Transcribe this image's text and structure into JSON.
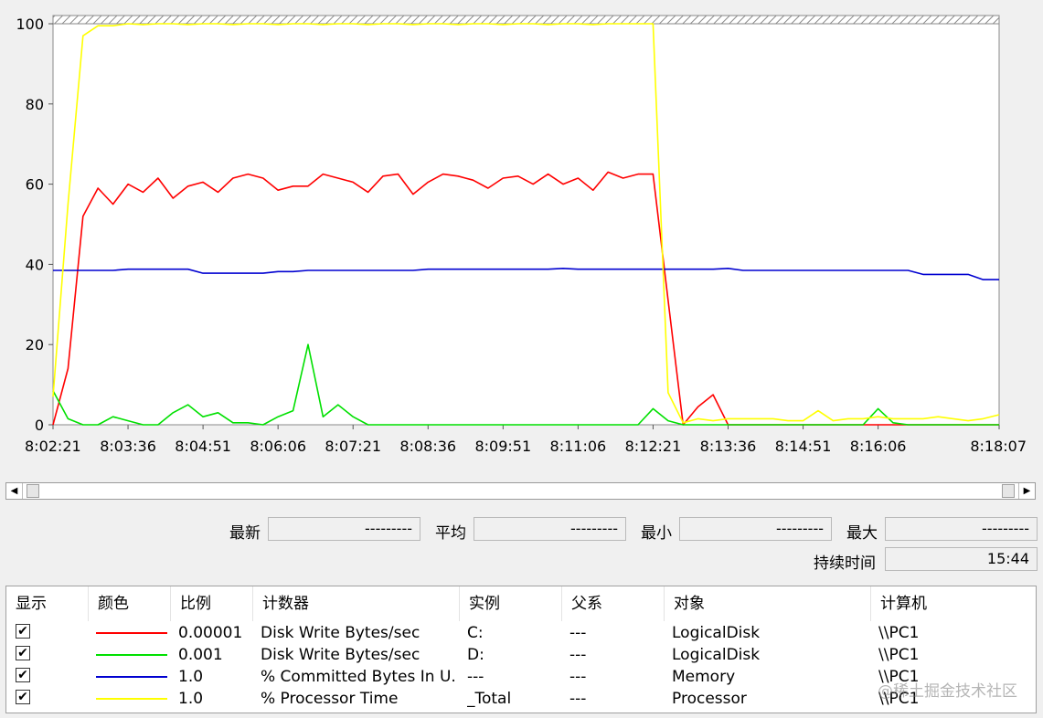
{
  "chart_data": {
    "type": "line",
    "ylim": [
      0,
      100
    ],
    "yticks": [
      "0",
      "20",
      "40",
      "60",
      "80",
      "100"
    ],
    "x_start": "8:02:21",
    "x_end": "8:18:07",
    "xticks": [
      "8:02:21",
      "8:03:36",
      "8:04:51",
      "8:06:06",
      "8:07:21",
      "8:08:36",
      "8:09:51",
      "8:11:06",
      "8:12:21",
      "8:13:36",
      "8:14:51",
      "8:16:06",
      "8:18:07"
    ],
    "grid": false,
    "x": [
      "8:02:21",
      "8:02:36",
      "8:02:51",
      "8:03:06",
      "8:03:21",
      "8:03:36",
      "8:03:51",
      "8:04:06",
      "8:04:21",
      "8:04:36",
      "8:04:51",
      "8:05:06",
      "8:05:21",
      "8:05:36",
      "8:05:51",
      "8:06:06",
      "8:06:21",
      "8:06:36",
      "8:06:51",
      "8:07:06",
      "8:07:21",
      "8:07:36",
      "8:07:51",
      "8:08:06",
      "8:08:21",
      "8:08:36",
      "8:08:51",
      "8:09:06",
      "8:09:21",
      "8:09:36",
      "8:09:51",
      "8:10:06",
      "8:10:21",
      "8:10:36",
      "8:10:51",
      "8:11:06",
      "8:11:21",
      "8:11:36",
      "8:11:51",
      "8:12:06",
      "8:12:21",
      "8:12:36",
      "8:12:51",
      "8:13:06",
      "8:13:21",
      "8:13:36",
      "8:13:51",
      "8:14:06",
      "8:14:21",
      "8:14:36",
      "8:14:51",
      "8:15:06",
      "8:15:21",
      "8:15:36",
      "8:15:51",
      "8:16:06",
      "8:16:21",
      "8:16:36",
      "8:16:51",
      "8:17:06",
      "8:17:21",
      "8:17:36",
      "8:17:51",
      "8:18:07"
    ],
    "series": [
      {
        "name": "Disk Write Bytes/sec C:",
        "color": "#ff0000",
        "values": [
          0,
          14,
          52,
          59,
          55,
          60,
          58,
          61.5,
          56.5,
          59.5,
          60.5,
          58,
          61.5,
          62.5,
          61.5,
          58.5,
          59.5,
          59.5,
          62.5,
          61.5,
          60.5,
          58,
          62,
          62.5,
          57.5,
          60.5,
          62.5,
          62,
          61,
          59,
          61.5,
          62,
          60,
          62.5,
          60,
          61.5,
          58.5,
          63,
          61.5,
          62.5,
          62.5,
          31,
          0,
          4.5,
          7.5,
          0,
          0,
          0,
          0,
          0,
          0,
          0,
          0,
          0,
          0,
          0,
          0,
          0,
          0,
          0,
          0,
          0,
          0,
          0
        ]
      },
      {
        "name": "Disk Write Bytes/sec D:",
        "color": "#00e000",
        "values": [
          8.5,
          1.5,
          0,
          0,
          2,
          1,
          0,
          0,
          3,
          5,
          2,
          3,
          0.5,
          0.5,
          0,
          2,
          3.5,
          20,
          2,
          5,
          2,
          0,
          0,
          0,
          0,
          0,
          0,
          0,
          0,
          0,
          0,
          0,
          0,
          0,
          0,
          0,
          0,
          0,
          0,
          0,
          4,
          1,
          0,
          0,
          0,
          0,
          0,
          0,
          0,
          0,
          0,
          0,
          0,
          0,
          0,
          4,
          0.5,
          0,
          0,
          0,
          0,
          0,
          0,
          0
        ]
      },
      {
        "name": "% Committed Bytes In Use",
        "color": "#0000d0",
        "values": [
          38.5,
          38.5,
          38.5,
          38.5,
          38.5,
          38.8,
          38.8,
          38.8,
          38.8,
          38.8,
          37.8,
          37.8,
          37.8,
          37.8,
          37.8,
          38.2,
          38.2,
          38.5,
          38.5,
          38.5,
          38.5,
          38.5,
          38.5,
          38.5,
          38.5,
          38.8,
          38.8,
          38.8,
          38.8,
          38.8,
          38.8,
          38.8,
          38.8,
          38.8,
          39,
          38.8,
          38.8,
          38.8,
          38.8,
          38.8,
          38.8,
          38.8,
          38.8,
          38.8,
          38.8,
          39,
          38.5,
          38.5,
          38.5,
          38.5,
          38.5,
          38.5,
          38.5,
          38.5,
          38.5,
          38.5,
          38.5,
          38.5,
          37.5,
          37.5,
          37.5,
          37.5,
          36.2,
          36.2
        ]
      },
      {
        "name": "% Processor Time",
        "color": "#ffff00",
        "values": [
          7,
          55,
          97,
          99.5,
          99.5,
          100,
          99.8,
          100,
          100,
          99.8,
          100,
          100,
          99.8,
          100,
          100,
          99.8,
          100,
          100,
          99.8,
          100,
          100,
          99.8,
          100,
          100,
          99.8,
          100,
          100,
          99.8,
          100,
          100,
          99.8,
          100,
          100,
          99.8,
          100,
          100,
          99.8,
          100,
          100,
          100,
          100,
          8,
          0.5,
          1.5,
          1,
          1.5,
          1.5,
          1.5,
          1.5,
          1,
          1,
          3.5,
          1,
          1.5,
          1.5,
          2,
          1.5,
          1.5,
          1.5,
          2,
          1.5,
          1,
          1.5,
          2.5
        ]
      }
    ]
  },
  "scrollbar": {
    "left_arrow": "◀",
    "right_arrow": "▶"
  },
  "stats": {
    "latest_label": "最新",
    "latest_value": "---------",
    "average_label": "平均",
    "average_value": "---------",
    "min_label": "最小",
    "min_value": "---------",
    "max_label": "最大",
    "max_value": "---------",
    "duration_label": "持续时间",
    "duration_value": "15:44"
  },
  "table": {
    "headers": {
      "show": "显示",
      "color": "颜色",
      "scale": "比例",
      "counter": "计数器",
      "instance": "实例",
      "parent": "父系",
      "object": "对象",
      "computer": "计算机"
    },
    "rows": [
      {
        "checked": "✔",
        "color": "#ff0000",
        "scale": "0.00001",
        "counter": "Disk Write Bytes/sec",
        "instance": "C:",
        "parent": "---",
        "object": "LogicalDisk",
        "computer": "\\\\PC1"
      },
      {
        "checked": "✔",
        "color": "#00e000",
        "scale": "0.001",
        "counter": "Disk Write Bytes/sec",
        "instance": "D:",
        "parent": "---",
        "object": "LogicalDisk",
        "computer": "\\\\PC1"
      },
      {
        "checked": "✔",
        "color": "#0000d0",
        "scale": "1.0",
        "counter": "% Committed Bytes In U...",
        "instance": "---",
        "parent": "---",
        "object": "Memory",
        "computer": "\\\\PC1"
      },
      {
        "checked": "✔",
        "color": "#ffff00",
        "scale": "1.0",
        "counter": "% Processor Time",
        "instance": "_Total",
        "parent": "---",
        "object": "Processor",
        "computer": "\\\\PC1"
      }
    ]
  },
  "watermark": "@稀土掘金技术社区"
}
